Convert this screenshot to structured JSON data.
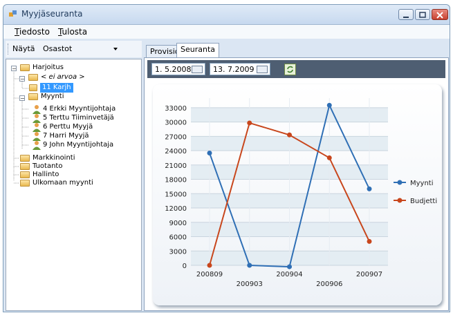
{
  "window": {
    "title": "Myyjäseuranta"
  },
  "menu": [
    "Tiedosto",
    "Tulosta"
  ],
  "toolbar": {
    "label": "Näytä",
    "combo_value": "Osastot"
  },
  "tree": {
    "root": "Harjoitus",
    "ei_arvoa": "< ei arvoa >",
    "ei_arvoa_child": "11 Karjh",
    "myynti": "Myynti",
    "myynti_children": [
      "4 Erkki Myyntijohtaja",
      "5 Terttu Tiiminvetäjä",
      "6 Perttu Myyjä",
      "7 Harri Myyjä",
      "9 John Myyntijohtaja"
    ],
    "others": [
      "Markkinointi",
      "Tuotanto",
      "Hallinto",
      "Ulkomaan myynti"
    ]
  },
  "tabs": [
    "Provisio",
    "Seuranta"
  ],
  "dates": {
    "from": "1. 5.2008",
    "to": "13. 7.2009"
  },
  "chart_data": {
    "type": "line",
    "categories": [
      "200809",
      "200903",
      "200904",
      "200906",
      "200907"
    ],
    "series": [
      {
        "name": "Myynti",
        "color": "#2f6fb5",
        "values": [
          23500,
          0,
          -300,
          33500,
          16000
        ]
      },
      {
        "name": "Budjetti",
        "color": "#c8461c",
        "values": [
          0,
          29800,
          27300,
          22500,
          5000
        ]
      }
    ],
    "yticks": [
      "0",
      "3000",
      "6000",
      "9000",
      "12000",
      "15000",
      "18000",
      "21000",
      "24000",
      "27000",
      "30000",
      "33000"
    ],
    "ylim": [
      0,
      35000
    ],
    "legend": "right"
  }
}
